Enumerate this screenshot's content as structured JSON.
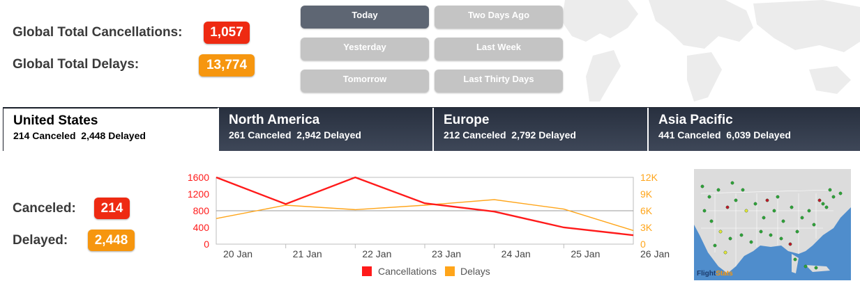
{
  "global": {
    "cancellations_label": "Global Total Cancellations:",
    "cancellations_value": "1,057",
    "delays_label": "Global Total Delays:",
    "delays_value": "13,774"
  },
  "time_buttons": [
    "Today",
    "Two Days Ago",
    "Yesterday",
    "Last Week",
    "Tomorrow",
    "Last Thirty Days"
  ],
  "regions": [
    {
      "name": "United States",
      "canceled": "214 Canceled",
      "delayed": "2,448 Delayed"
    },
    {
      "name": "North America",
      "canceled": "261 Canceled",
      "delayed": "2,942 Delayed"
    },
    {
      "name": "Europe",
      "canceled": "212 Canceled",
      "delayed": "2,792 Delayed"
    },
    {
      "name": "Asia Pacific",
      "canceled": "441 Canceled",
      "delayed": "6,039 Delayed"
    }
  ],
  "detail": {
    "canceled_label": "Canceled:",
    "canceled_value": "214",
    "delayed_label": "Delayed:",
    "delayed_value": "2,448"
  },
  "map_logo": {
    "part1": "Flight",
    "part2": "Stats"
  },
  "colors": {
    "cancellations": "#ff1a1a",
    "delays": "#ffa51a",
    "active_button": "#5e6673",
    "inactive_button": "#c4c4c4"
  },
  "chart_data": {
    "type": "line",
    "categories": [
      "20 Jan",
      "21 Jan",
      "22 Jan",
      "23 Jan",
      "24 Jan",
      "25 Jan",
      "26 Jan"
    ],
    "series": [
      {
        "name": "Cancellations",
        "axis": "left",
        "values": [
          1600,
          960,
          1600,
          980,
          780,
          400,
          214
        ]
      },
      {
        "name": "Delays",
        "axis": "right",
        "values": [
          4600,
          7000,
          6200,
          7000,
          8000,
          6300,
          2448
        ]
      }
    ],
    "yleft": {
      "ticks": [
        "1600",
        "1200",
        "800",
        "400",
        "0"
      ],
      "lim": [
        0,
        1600
      ]
    },
    "yright": {
      "ticks": [
        "12K",
        "9K",
        "6K",
        "3K",
        "0"
      ],
      "lim": [
        0,
        12000
      ]
    },
    "legend": [
      "Cancellations",
      "Delays"
    ],
    "legend_position": "bottom",
    "grid": "horizontal-mid"
  }
}
